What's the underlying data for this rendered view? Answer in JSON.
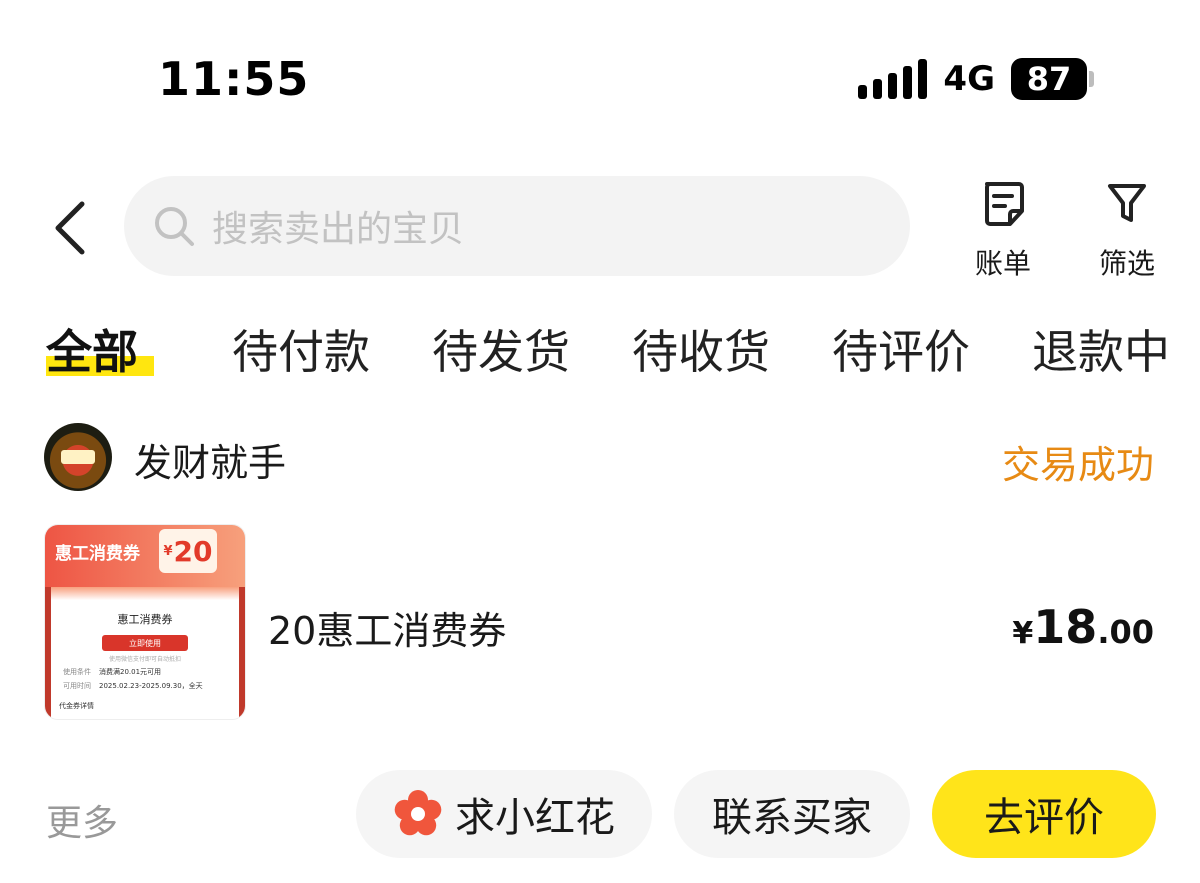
{
  "status_bar": {
    "time": "11:55",
    "network": "4G",
    "battery": "87"
  },
  "header": {
    "search_placeholder": "搜索卖出的宝贝",
    "bill_label": "账单",
    "filter_label": "筛选"
  },
  "tabs": [
    {
      "label": "全部",
      "active": true
    },
    {
      "label": "待付款",
      "active": false
    },
    {
      "label": "待发货",
      "active": false
    },
    {
      "label": "待收货",
      "active": false
    },
    {
      "label": "待评价",
      "active": false
    },
    {
      "label": "退款中",
      "active": false
    }
  ],
  "order": {
    "shop_name": "发财就手",
    "status": "交易成功",
    "product_title": "20惠工消费券",
    "price_symbol": "¥",
    "price_integer": "18",
    "price_decimal": ".00",
    "thumbnail": {
      "title": "惠工消费券",
      "amount_symbol": "¥",
      "amount": "20",
      "name": "惠工消费券",
      "button": "立即使用",
      "note": "使用微信支付即可自动抵扣",
      "condition_label": "使用条件",
      "condition_value": "消费满20.01元可用",
      "time_label": "可用时间",
      "time_value": "2025.02.23-2025.09.30，全天",
      "footer": "代金券详情"
    }
  },
  "actions": {
    "more": "更多",
    "flower": "求小红花",
    "contact": "联系买家",
    "review": "去评价"
  },
  "colors": {
    "accent_yellow": "#ffe41a",
    "status_orange": "#e78a14",
    "flower_red": "#f0563c"
  }
}
